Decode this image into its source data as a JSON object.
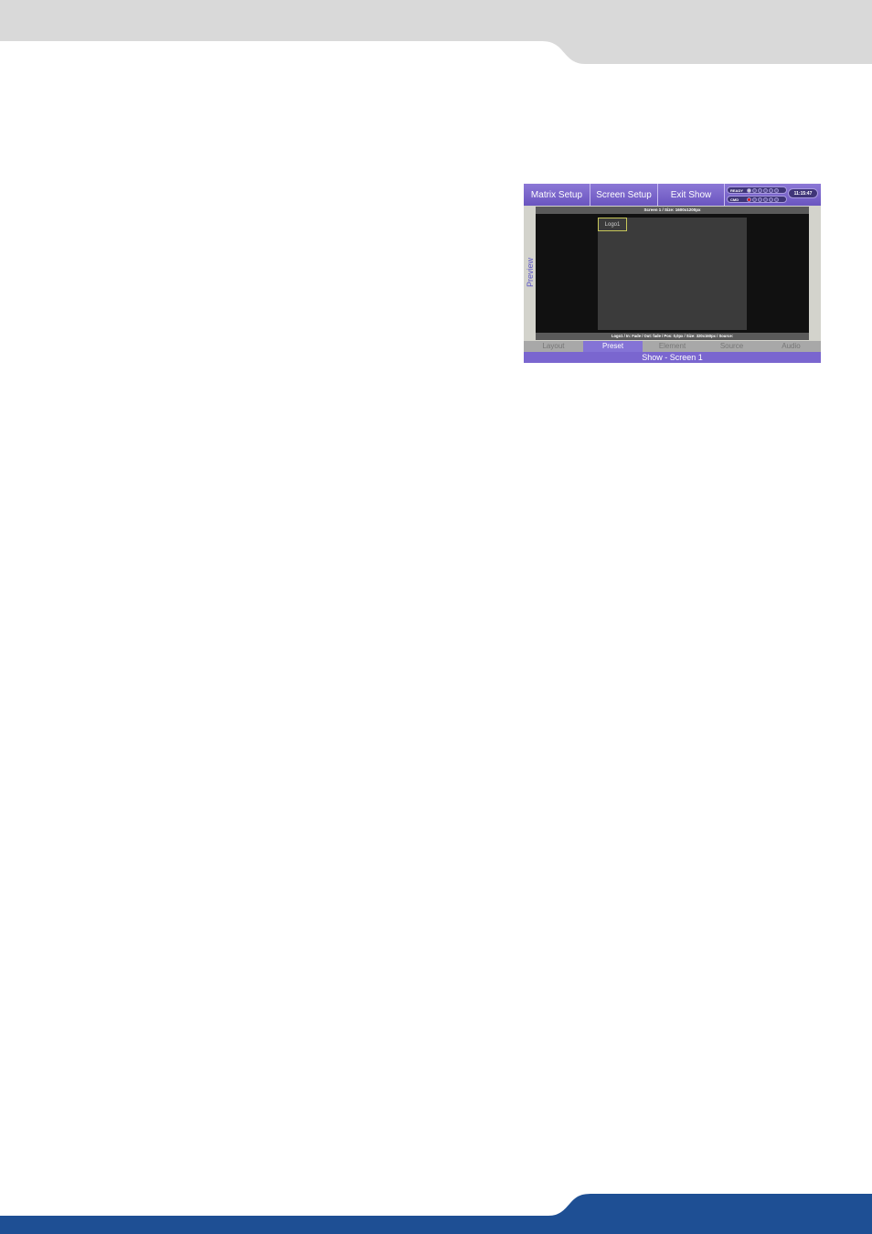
{
  "colors": {
    "page_top_band": "#d9d9d9",
    "page_bottom_band": "#1e4f94",
    "toolbar": "#7a66cf",
    "active_tab": "#8473d6"
  },
  "toolbar": {
    "matrix_setup": "Matrix Setup",
    "screen_setup": "Screen Setup",
    "exit_show": "Exit Show"
  },
  "status": {
    "ready_label": "READY",
    "cmd_label": "CMD",
    "clock": "11:15:47"
  },
  "preview": {
    "side_label": "Preview",
    "header": "Screen 1  /  Size: 1600x1200px",
    "element_label": "Logo1",
    "footer": "Logo1  /  In: Fade  /  Out: fade  /  Pos: 0,0px  /  Size: 320x160px  /  Source:"
  },
  "tabs": [
    {
      "label": "Layout",
      "active": false
    },
    {
      "label": "Preset",
      "active": true
    },
    {
      "label": "Element",
      "active": false
    },
    {
      "label": "Source",
      "active": false
    },
    {
      "label": "Audio",
      "active": false
    }
  ],
  "footer_title": "Show - Screen 1"
}
